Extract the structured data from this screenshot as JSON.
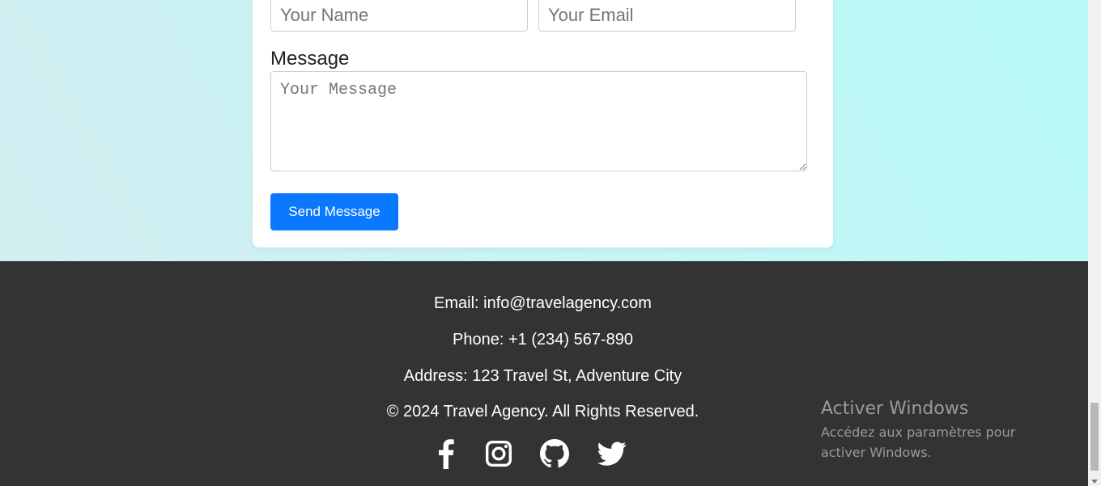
{
  "contact_form": {
    "name_placeholder": "Your Name",
    "email_placeholder": "Your Email",
    "message_label": "Message",
    "message_placeholder": "Your Message",
    "send_label": "Send Message"
  },
  "footer": {
    "email": "Email: info@travelagency.com",
    "phone": "Phone: +1 (234) 567-890",
    "address": "Address: 123 Travel St, Adventure City",
    "copyright": "© 2024 Travel Agency. All Rights Reserved.",
    "social_icons": [
      "facebook-icon",
      "instagram-icon",
      "github-icon",
      "twitter-icon"
    ]
  },
  "watermark": {
    "title": "Activer Windows",
    "text": "Accédez aux paramètres pour activer Windows."
  },
  "colors": {
    "accent": "#0a78ff",
    "footer_bg": "#333333",
    "section_bg": "#c6f4f5"
  }
}
